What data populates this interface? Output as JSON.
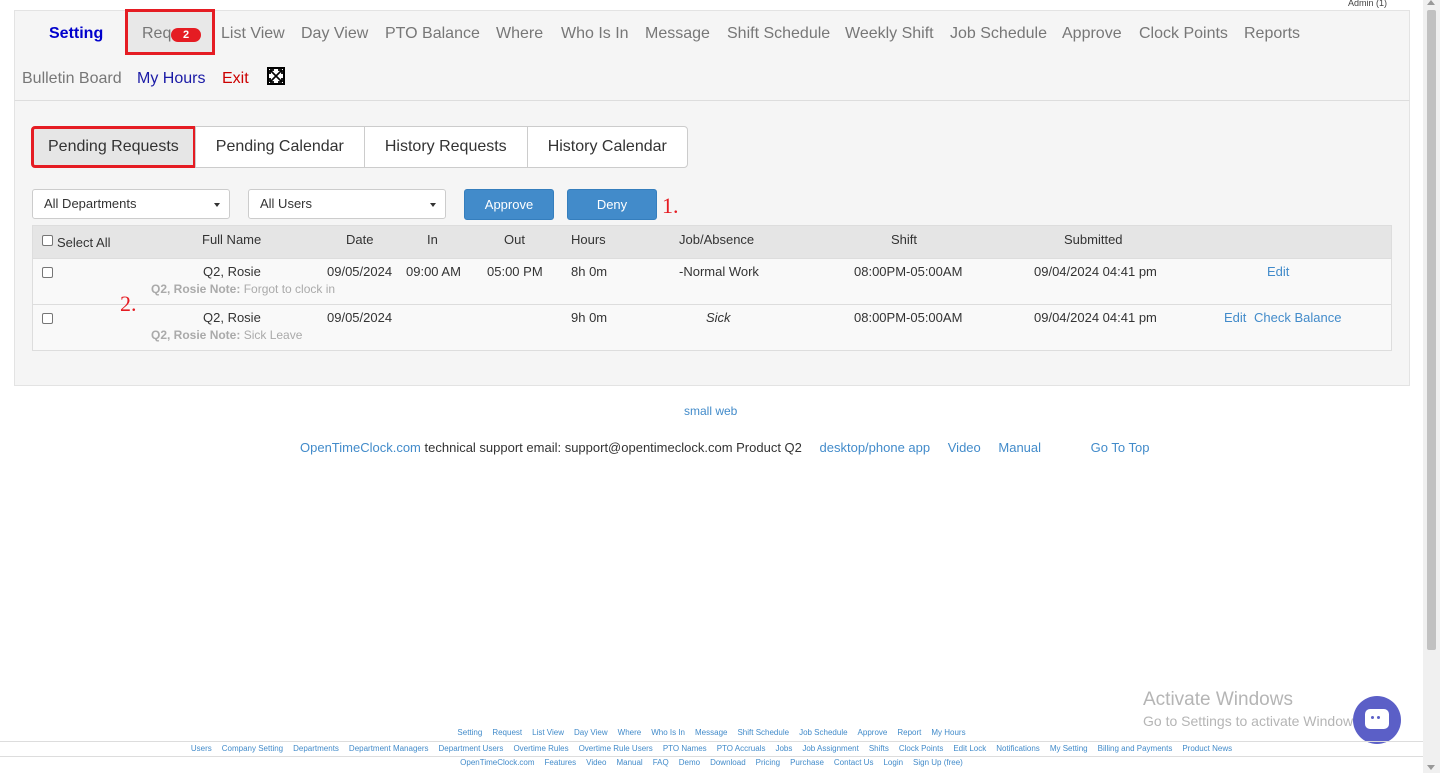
{
  "admin": "Admin (1)",
  "nav": {
    "row1": [
      "Setting",
      "Req",
      "List View",
      "Day View",
      "PTO Balance",
      "Where",
      "Who Is In",
      "Message",
      "Shift Schedule",
      "Weekly Shift",
      "Job Schedule",
      "Approve",
      "Clock Points",
      "Reports"
    ],
    "row2": [
      "Bulletin Board",
      "My Hours",
      "Exit"
    ],
    "req_badge": "2"
  },
  "tabs": [
    "Pending Requests",
    "Pending Calendar",
    "History Requests",
    "History Calendar"
  ],
  "filters": {
    "departments": "All Departments",
    "users": "All Users",
    "approve": "Approve",
    "deny": "Deny"
  },
  "annotations": {
    "one": "1.",
    "two": "2."
  },
  "table": {
    "select_all": "Select All",
    "headers": [
      "Full Name",
      "Date",
      "In",
      "Out",
      "Hours",
      "Job/Absence",
      "Shift",
      "Submitted"
    ],
    "rows": [
      {
        "name": "Q2, Rosie",
        "date": "09/05/2024",
        "in": "09:00 AM",
        "out": "05:00 PM",
        "hours": "8h 0m",
        "job": "-Normal Work",
        "shift": "08:00PM-05:00AM",
        "submitted": "09/04/2024 04:41 pm",
        "note_label": "Q2, Rosie Note:",
        "note": "Forgot to clock in",
        "edit": "Edit",
        "check": ""
      },
      {
        "name": "Q2, Rosie",
        "date": "09/05/2024",
        "in": "",
        "out": "",
        "hours": "9h 0m",
        "job": "Sick",
        "shift": "08:00PM-05:00AM",
        "submitted": "09/04/2024 04:41 pm",
        "note_label": "Q2, Rosie Note:",
        "note": "Sick Leave",
        "edit": "Edit",
        "check": "Check Balance"
      }
    ]
  },
  "footer": {
    "small_web": "small web",
    "site": "OpenTimeClock.com",
    "support_text": "technical support email: support@opentimeclock.com Product Q2",
    "app": "desktop/phone app",
    "video": "Video",
    "manual": "Manual",
    "top": "Go To Top"
  },
  "activate": {
    "title": "Activate Windows",
    "sub": "Go to Settings to activate Windows."
  },
  "bottom_menu": {
    "row1": [
      "Setting",
      "Request",
      "List View",
      "Day View",
      "Where",
      "Who Is In",
      "Message",
      "Shift Schedule",
      "Job Schedule",
      "Approve",
      "Report",
      "My Hours"
    ],
    "row2": [
      "Users",
      "Company Setting",
      "Departments",
      "Department Managers",
      "Department Users",
      "Overtime Rules",
      "Overtime Rule Users",
      "PTO Names",
      "PTO Accruals",
      "Jobs",
      "Job Assignment",
      "Shifts",
      "Clock Points",
      "Edit Lock",
      "Notifications",
      "My Setting",
      "Billing and Payments",
      "Product News"
    ],
    "row3": [
      "OpenTimeClock.com",
      "Features",
      "Video",
      "Manual",
      "FAQ",
      "Demo",
      "Download",
      "Pricing",
      "Purchase",
      "Contact Us",
      "Login",
      "Sign Up (free)"
    ]
  }
}
